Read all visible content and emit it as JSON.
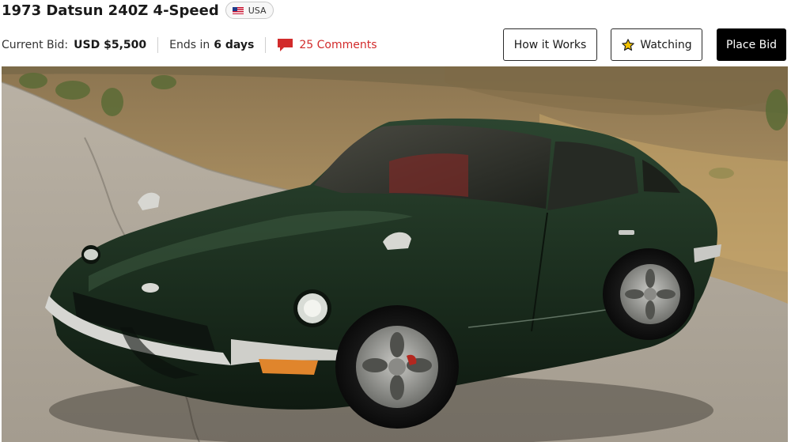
{
  "listing": {
    "title": "1973 Datsun 240Z 4-Speed",
    "country": "USA",
    "country_flag_icon": "us-flag-icon"
  },
  "meta": {
    "current_bid_label": "Current Bid:",
    "current_bid_value": "USD $5,500",
    "ends_label": "Ends in",
    "ends_value": "6 days",
    "comments_label": "25 Comments",
    "comments_icon": "comment-icon"
  },
  "actions": {
    "how_it_works_label": "How it Works",
    "watching_label": "Watching",
    "watching_icon": "star-icon",
    "place_bid_label": "Place Bid"
  },
  "photo": {
    "subject": "car-photo"
  },
  "colors": {
    "accent_red": "#d22b2b",
    "primary_button_bg": "#000000",
    "car_body": "#1f3422"
  }
}
